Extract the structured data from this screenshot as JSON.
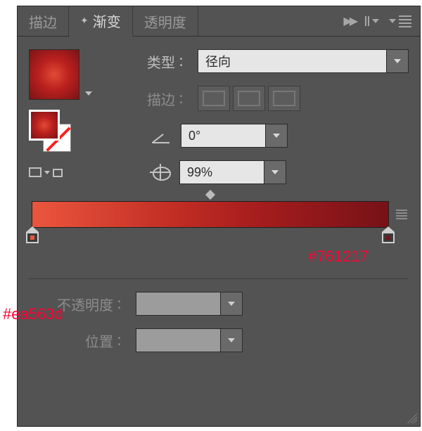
{
  "tabs": {
    "stroke": "描边",
    "gradient": "渐变",
    "transparency": "透明度",
    "change_indicator": "✦"
  },
  "labels": {
    "type": "类型",
    "stroke": "描边",
    "opacity": "不透明度",
    "position": "位置",
    "colon": "："
  },
  "values": {
    "type_selected": "径向",
    "angle": "0°",
    "aspect": "99%",
    "opacity": "",
    "position": ""
  },
  "gradient": {
    "stop_left_color": "#ea563d",
    "stop_right_color": "#761217"
  },
  "annotations": {
    "right_hex": "#761217",
    "left_hex": "#ea563d"
  }
}
